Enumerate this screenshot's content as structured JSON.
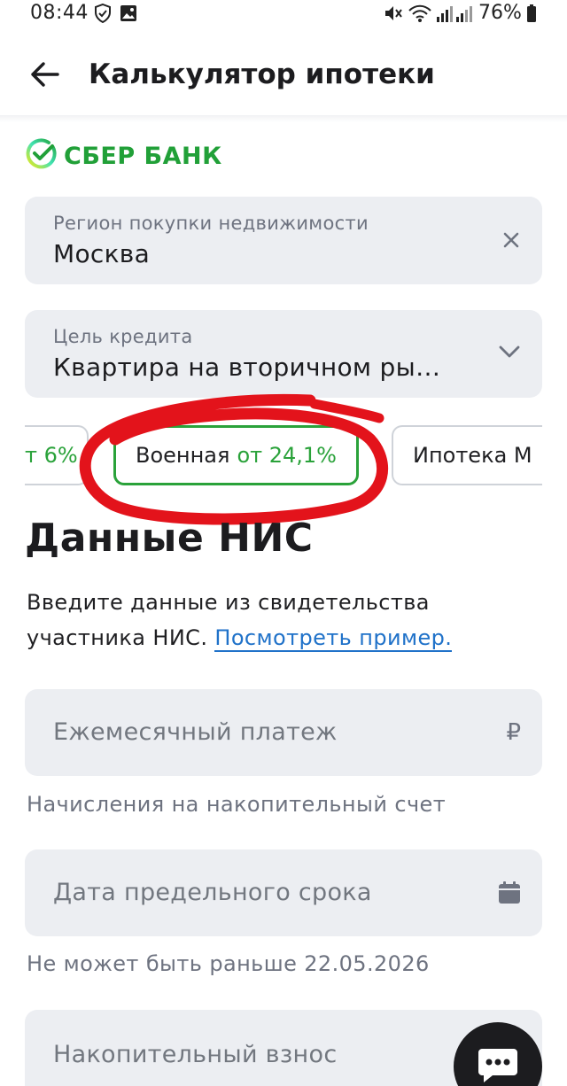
{
  "status_bar": {
    "time": "08:44",
    "battery": "76%"
  },
  "app_bar": {
    "title": "Калькулятор ипотеки"
  },
  "brand": {
    "name": "СБЕР БАНК",
    "color": "#21a038"
  },
  "region_field": {
    "label": "Регион покупки недвижимости",
    "value": "Москва"
  },
  "purpose_field": {
    "label": "Цель кредита",
    "value": "Квартира на вторичном ры…"
  },
  "programs": [
    {
      "label": "",
      "rate": "т 6%"
    },
    {
      "label": "Военная",
      "rate": "от 24,1%",
      "selected": true
    },
    {
      "label": "Ипотека М",
      "rate": ""
    }
  ],
  "section": {
    "title": "Данные НИС",
    "desc_text": "Введите данные из свидетельства участника НИС. ",
    "desc_link": "Посмотреть пример."
  },
  "monthly_payment": {
    "placeholder": "Ежемесячный платеж",
    "currency": "₽",
    "helper": "Начисления на накопительный счет"
  },
  "deadline_date": {
    "placeholder": "Дата предельного срока",
    "helper": "Не может быть раньше 22.05.2026"
  },
  "savings_contribution": {
    "placeholder": "Накопительный взнос"
  },
  "colors": {
    "accent_green": "#2aa23a",
    "link_blue": "#2072c9",
    "annotation_red": "#e3131b",
    "field_bg": "#eceef2"
  }
}
